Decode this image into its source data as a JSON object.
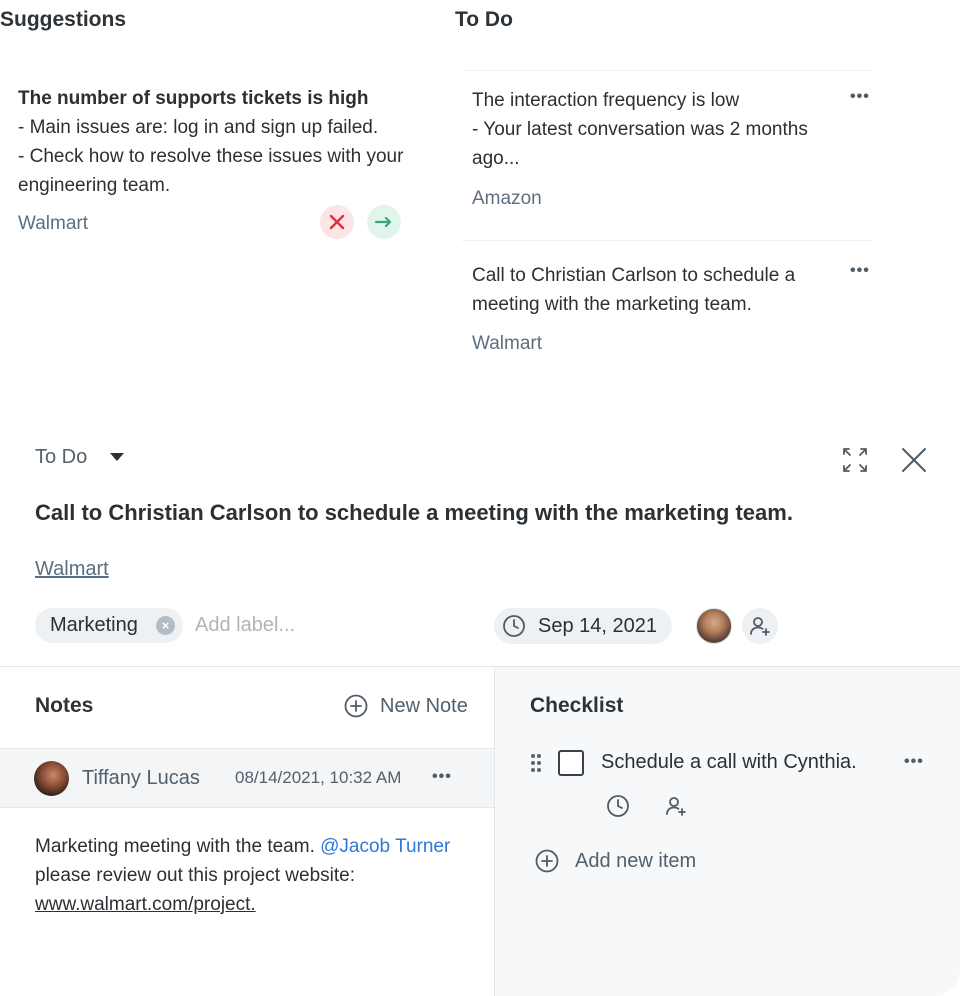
{
  "board": {
    "suggestions_title": "Suggestions",
    "todo_title": "To Do",
    "suggestion_card": {
      "heading": "The number of supports tickets is high",
      "line1": "- Main issues are: log in and sign up failed.",
      "line2": "- Check how to resolve these issues with your engineering team.",
      "company": "Walmart"
    },
    "todo_cards": [
      {
        "line1": "The interaction frequency is low",
        "line2": "- Your latest conversation was 2 months ago...",
        "company": "Amazon"
      },
      {
        "line1": "Call to Christian Carlson to schedule a meeting with the marketing team.",
        "company": "Walmart"
      }
    ],
    "more_glyph": "•••"
  },
  "detail": {
    "status": "To Do",
    "title": "Call to Christian Carlson to schedule a meeting with the marketing team.",
    "company": "Walmart",
    "label": "Marketing",
    "add_label_placeholder": "Add label...",
    "due_date": "Sep 14, 2021"
  },
  "notes": {
    "title": "Notes",
    "new_note_label": "New Note",
    "entry": {
      "author": "Tiffany Lucas",
      "timestamp": "08/14/2021, 10:32 AM",
      "text_before": "Marketing meeting with the team.",
      "mention": "@Jacob Turner",
      "text_after": "please review out this project website:",
      "link": "www.walmart.com/project."
    }
  },
  "checklist": {
    "title": "Checklist",
    "items": [
      {
        "text": "Schedule a call with Cynthia.",
        "checked": false
      }
    ],
    "add_item_label": "Add new item"
  },
  "colors": {
    "accent_link": "#2f78d6",
    "dismiss_red": "#e0313b",
    "accept_green": "#3aa877",
    "muted_text": "#5b6f80"
  },
  "icons": [
    "x-icon",
    "arrow-right-icon",
    "more-icon",
    "caret-down-icon",
    "expand-icon",
    "close-icon",
    "remove-icon",
    "clock-icon",
    "add-person-icon",
    "plus-circle-icon",
    "drag-handle-icon"
  ]
}
